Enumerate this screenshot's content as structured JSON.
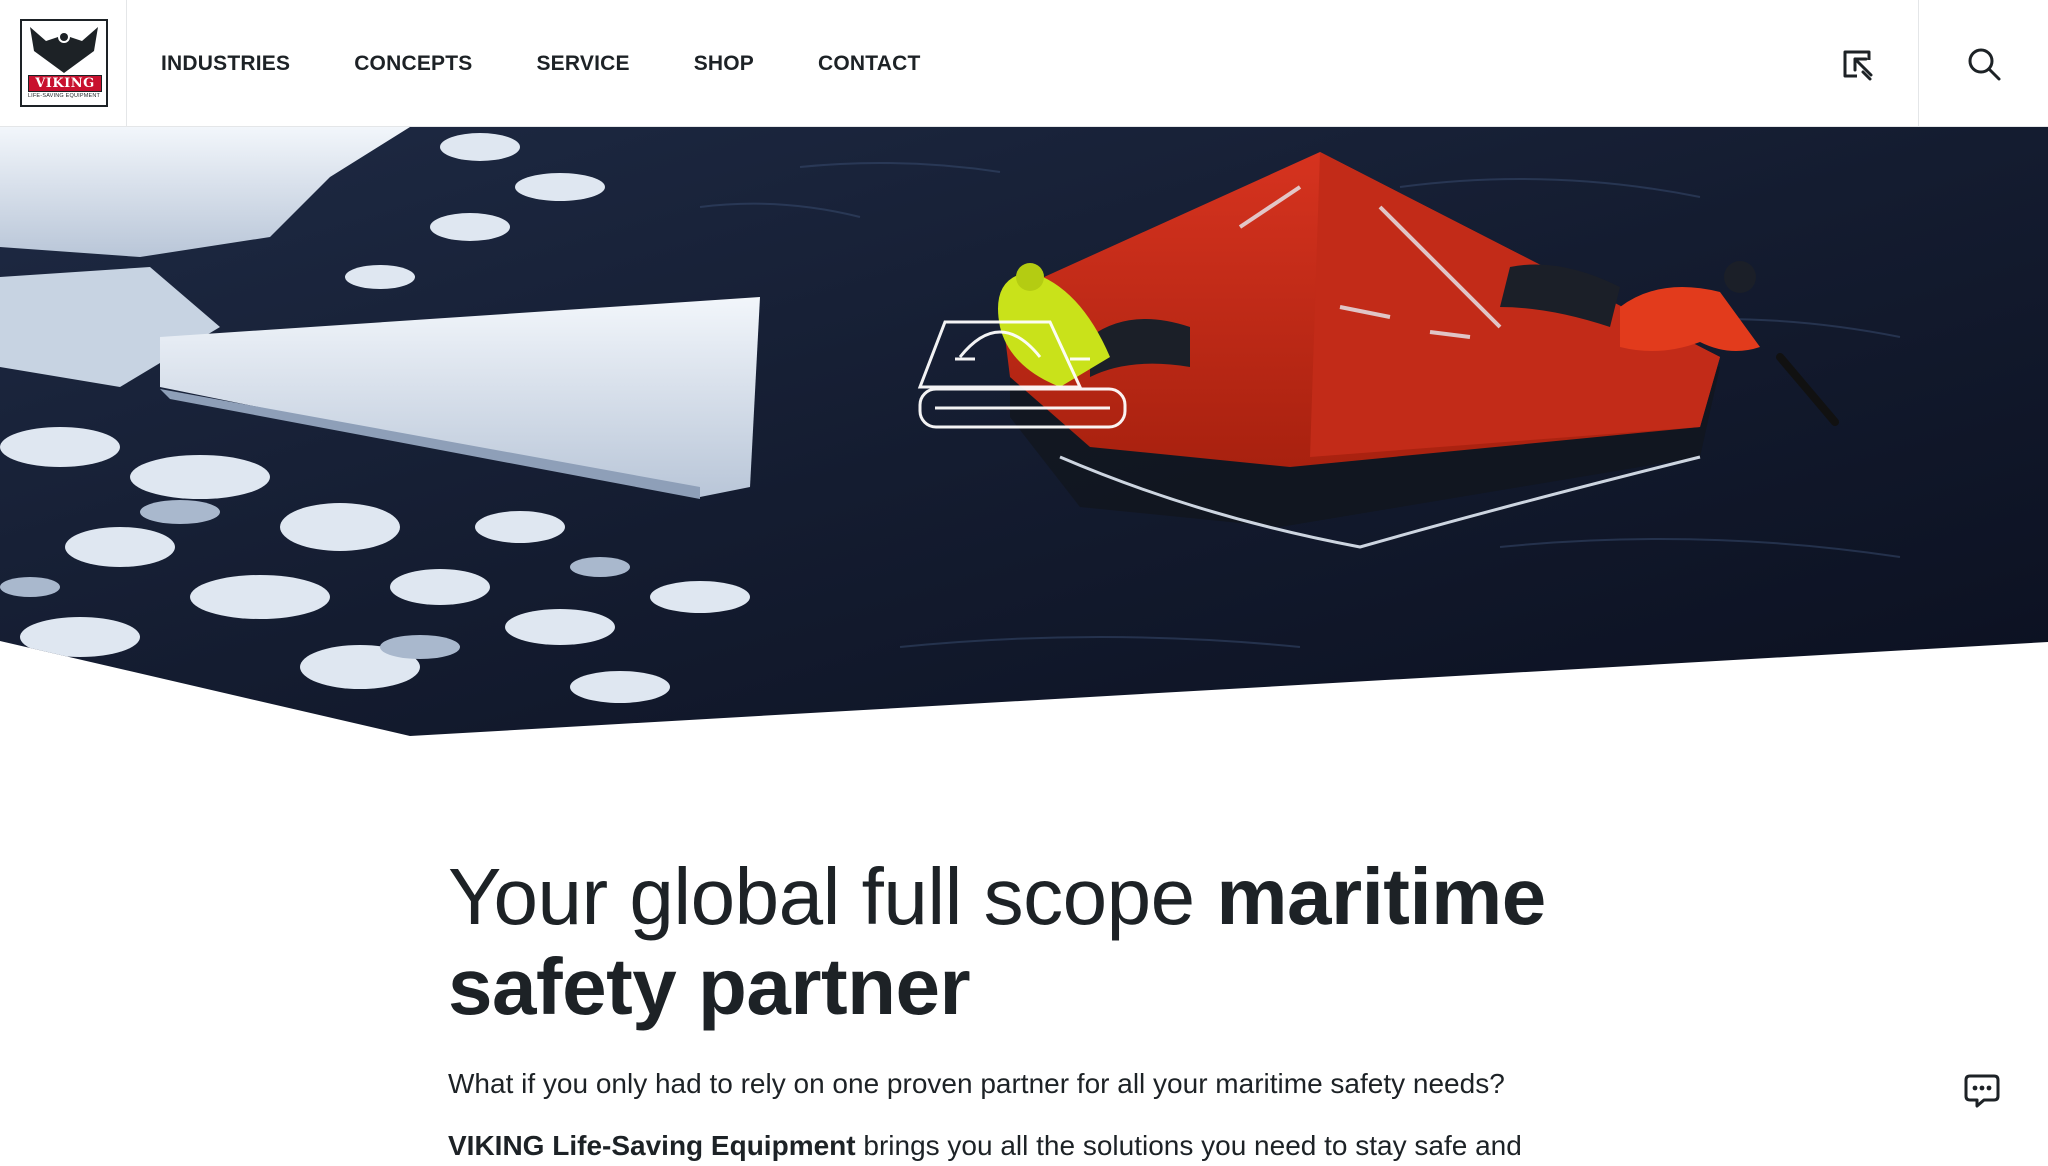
{
  "brand": {
    "name": "VIKING",
    "tagline": "LIFE-SAVING EQUIPMENT",
    "colors": {
      "brand_red": "#c8102e",
      "text_dark": "#1d2226"
    }
  },
  "nav": {
    "items": [
      {
        "label": "INDUSTRIES"
      },
      {
        "label": "CONCEPTS"
      },
      {
        "label": "SERVICE"
      },
      {
        "label": "SHOP"
      },
      {
        "label": "CONTACT"
      }
    ]
  },
  "header_icons": {
    "compare": "compare-icon",
    "search": "search-icon"
  },
  "hero": {
    "image": "Liferaft in icy water with two crew members",
    "overlay_icon": "liferaft-outline-icon"
  },
  "main": {
    "headline_light": "Your global full scope ",
    "headline_bold": "maritime safety partner",
    "intro": "What if you only had to rely on one proven partner for all your maritime safety needs?",
    "intro2_bold": "VIKING Life-Saving Equipment",
    "intro2_rest": " brings you all the solutions you need to stay safe and"
  },
  "chat": {
    "icon": "chat-icon"
  }
}
